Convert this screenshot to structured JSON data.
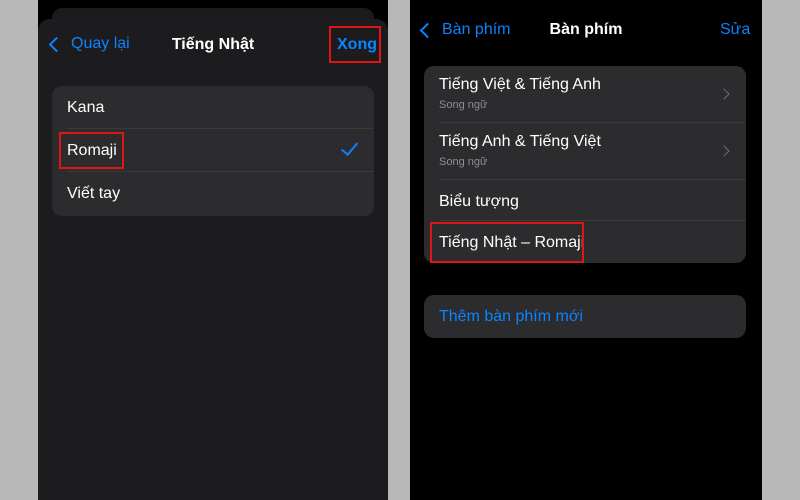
{
  "left": {
    "nav": {
      "back_label": "Quay lại",
      "title": "Tiếng Nhật",
      "done_label": "Xong"
    },
    "options": [
      {
        "label": "Kana",
        "selected": false
      },
      {
        "label": "Romaji",
        "selected": true
      },
      {
        "label": "Viết tay",
        "selected": false
      }
    ]
  },
  "right": {
    "nav": {
      "back_label": "Bàn phím",
      "title": "Bàn phím",
      "edit_label": "Sửa"
    },
    "keyboards": [
      {
        "label": "Tiếng Việt & Tiếng Anh",
        "subtitle": "Song ngữ"
      },
      {
        "label": "Tiếng Anh & Tiếng Việt",
        "subtitle": "Song ngữ"
      },
      {
        "label": "Biểu tượng"
      },
      {
        "label": "Tiếng Nhật – Romaji"
      }
    ],
    "add_keyboard_label": "Thêm bàn phím mới"
  },
  "colors": {
    "accent": "#0a84ff",
    "highlight": "#e01515",
    "background": "#000000",
    "cell": "#2c2c2e",
    "sheet": "#1c1c1e"
  }
}
